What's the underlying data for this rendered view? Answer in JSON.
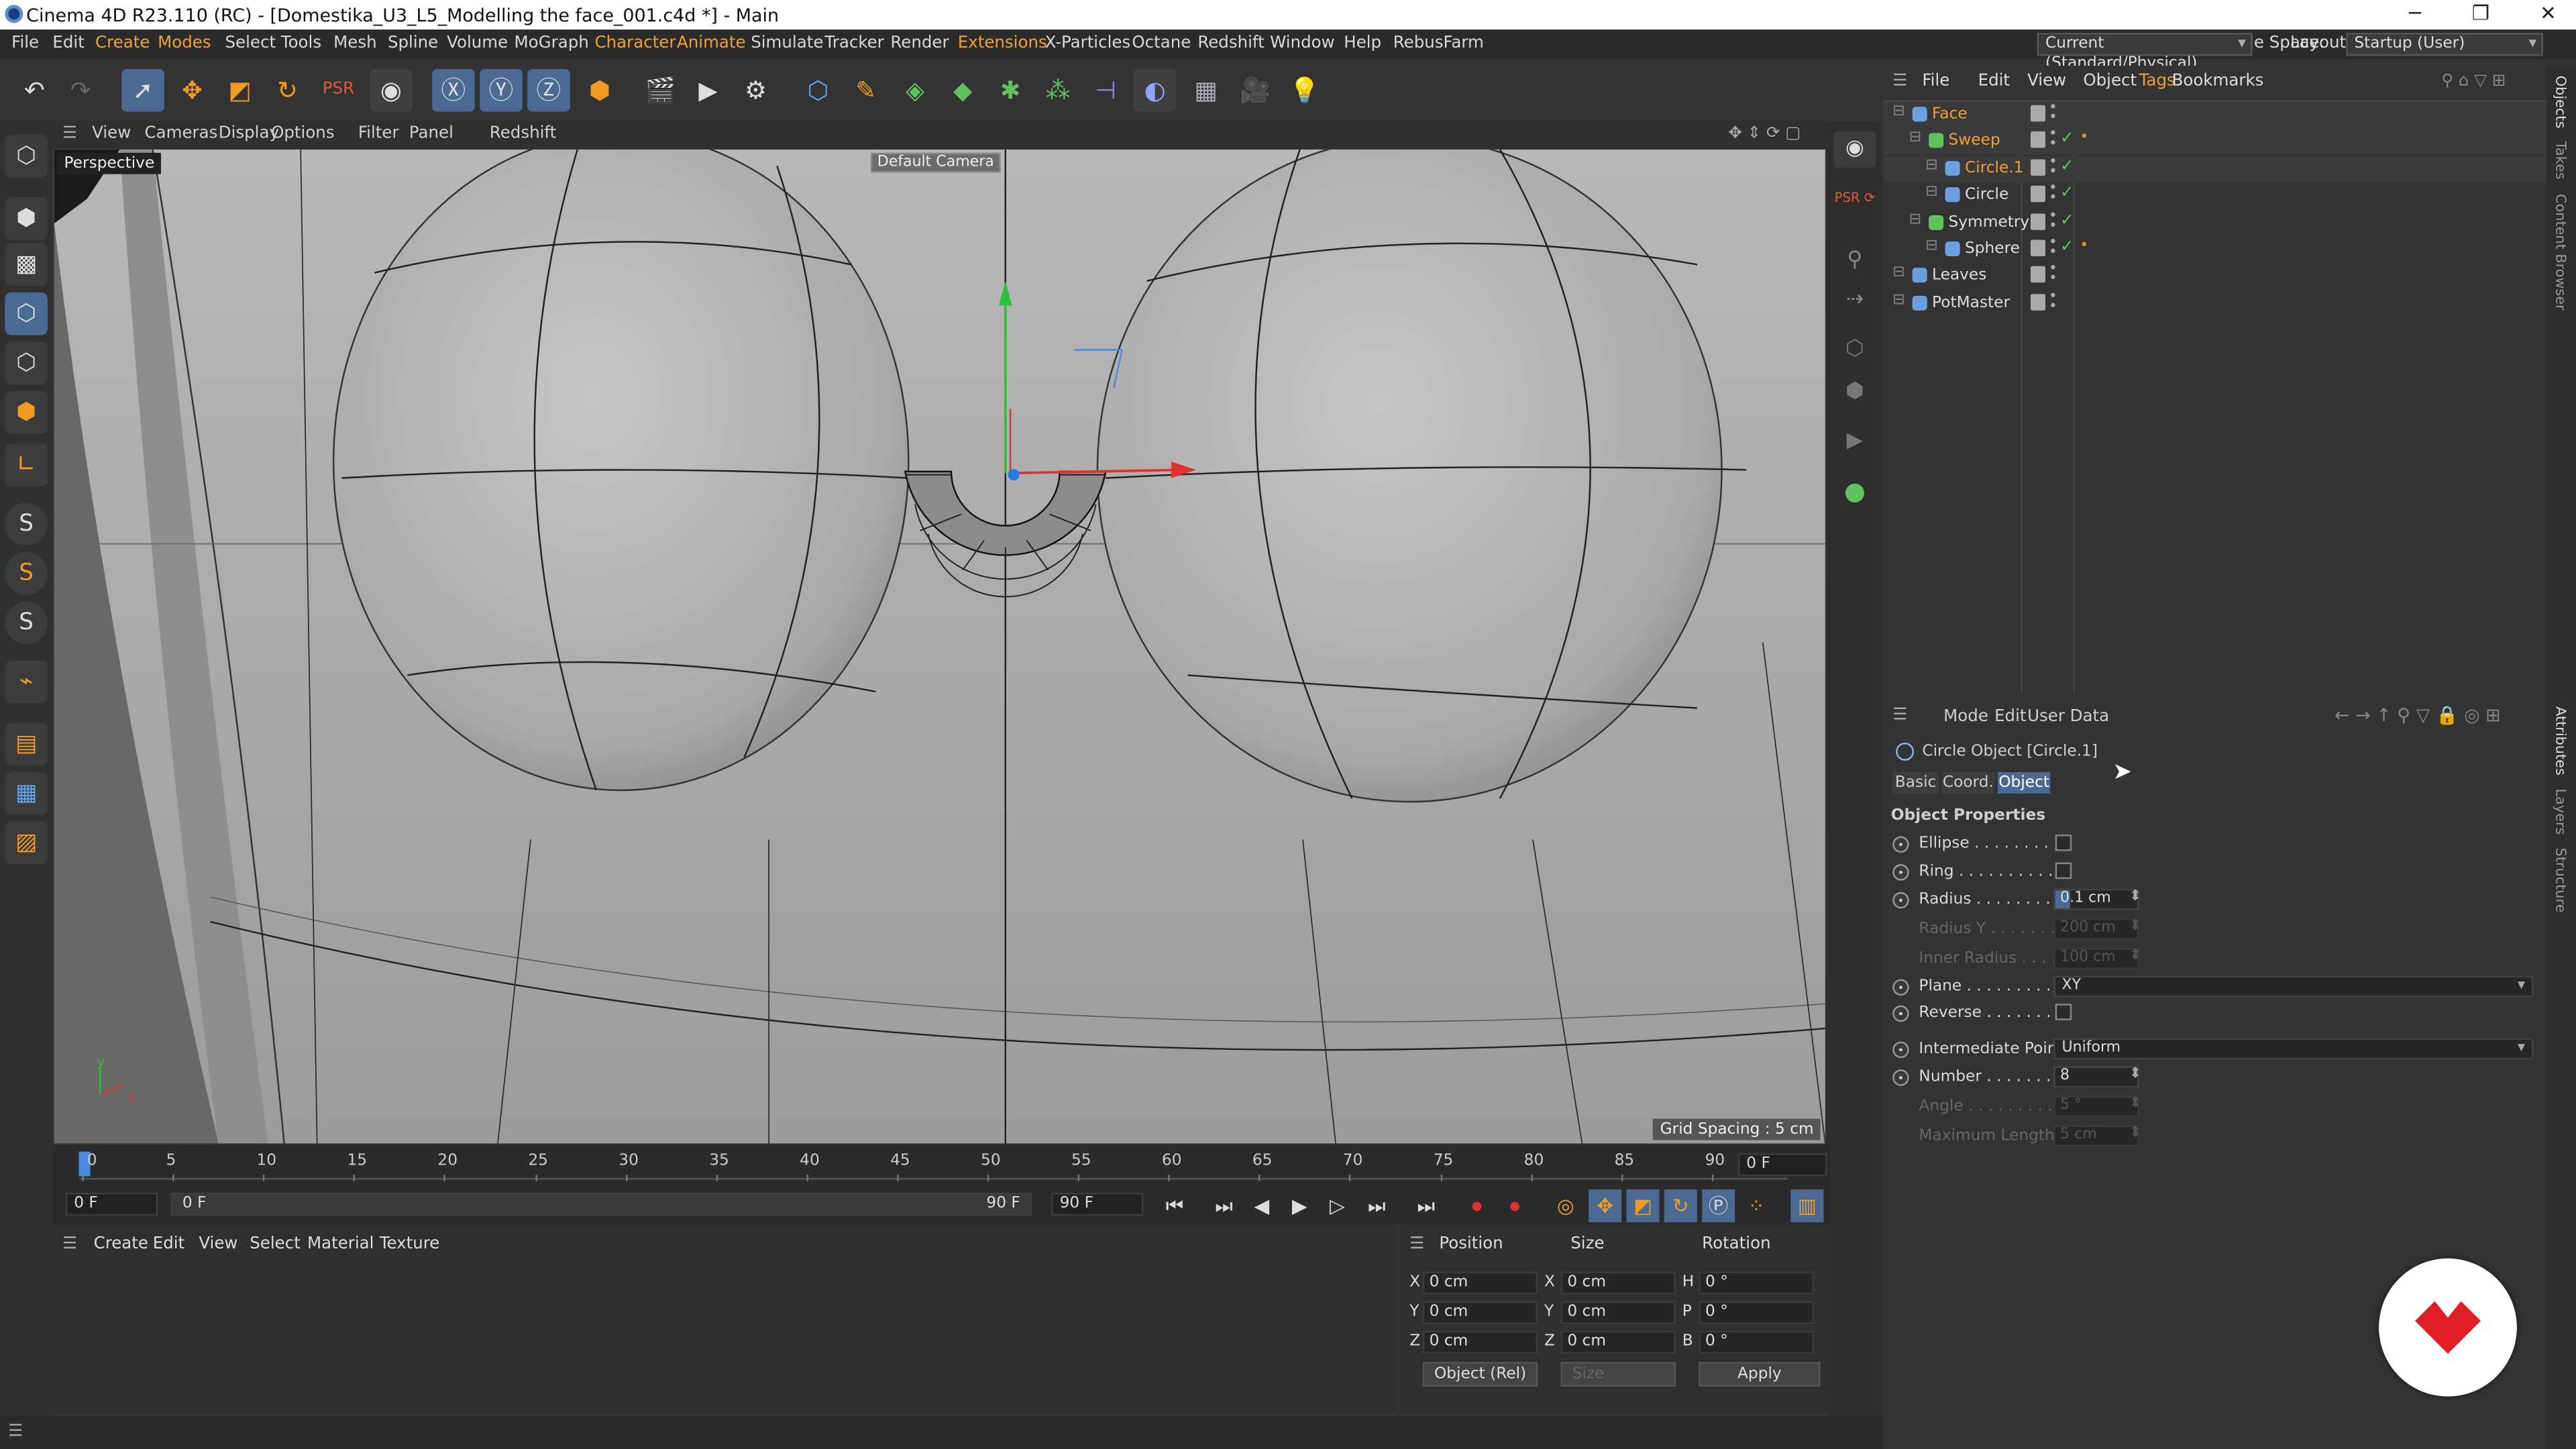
{
  "window": {
    "title": "Cinema 4D R23.110 (RC) - [Domestika_U3_L5_Modelling the face_001.c4d *] - Main",
    "minimize": "─",
    "restore": "❐",
    "close": "✕"
  },
  "menubar": {
    "items": [
      "File",
      "Edit",
      "Create",
      "Modes",
      "Select",
      "Tools",
      "Mesh",
      "Spline",
      "Volume",
      "MoGraph",
      "Character",
      "Animate",
      "Simulate",
      "Tracker",
      "Render",
      "Extensions",
      "X-Particles",
      "Octane",
      "Redshift",
      "Window",
      "Help",
      "RebusFarm"
    ],
    "node_space_label": "Node Space:",
    "node_space_value": "Current (Standard/Physical)",
    "layout_label": "Layout:",
    "layout_value": "Startup (User)"
  },
  "viewport": {
    "menu": [
      "View",
      "Cameras",
      "Display",
      "Options",
      "Filter",
      "Panel",
      "Redshift"
    ],
    "label": "Perspective",
    "camera": "Default Camera",
    "grid_spacing": "Grid Spacing : 5 cm",
    "axis_y": "y",
    "axis_x": "x"
  },
  "timeline": {
    "ticks": [
      "0",
      "5",
      "10",
      "15",
      "20",
      "25",
      "30",
      "35",
      "40",
      "45",
      "50",
      "55",
      "60",
      "65",
      "70",
      "75",
      "80",
      "85",
      "90"
    ],
    "current_frame": "0 F",
    "start_field": "0 F",
    "range_start": "0 F",
    "range_end": "90 F",
    "end_field": "90 F",
    "right_field": "0 F"
  },
  "material_manager": {
    "menu": [
      "Create",
      "Edit",
      "View",
      "Select",
      "Material",
      "Texture"
    ]
  },
  "coordinates": {
    "headers": {
      "position": "Position",
      "size": "Size",
      "rotation": "Rotation"
    },
    "rows": [
      {
        "axis": "X",
        "pos": "0 cm",
        "size_axis": "X",
        "size": "0 cm",
        "rot_axis": "H",
        "rot": "0 °"
      },
      {
        "axis": "Y",
        "pos": "0 cm",
        "size_axis": "Y",
        "size": "0 cm",
        "rot_axis": "P",
        "rot": "0 °"
      },
      {
        "axis": "Z",
        "pos": "0 cm",
        "size_axis": "Z",
        "size": "0 cm",
        "rot_axis": "B",
        "rot": "0 °"
      }
    ],
    "mode": "Object (Rel)",
    "size_mode": "Size",
    "apply": "Apply"
  },
  "object_manager": {
    "menu": [
      "File",
      "Edit",
      "View",
      "Object",
      "Tags",
      "Bookmarks"
    ],
    "objects": [
      {
        "name": "Face",
        "indent": 0,
        "color": "#f0a030",
        "icon_color": "#6aa0e0",
        "tag": false
      },
      {
        "name": "Sweep",
        "indent": 1,
        "color": "#f0a030",
        "icon_color": "#5fc25f",
        "tag": true
      },
      {
        "name": "Circle.1",
        "indent": 2,
        "color": "#f0a030",
        "icon_color": "#6aa0e0",
        "tag": false
      },
      {
        "name": "Circle",
        "indent": 2,
        "color": "#dddddd",
        "icon_color": "#6aa0e0",
        "tag": false
      },
      {
        "name": "Symmetry",
        "indent": 1,
        "color": "#dddddd",
        "icon_color": "#5fc25f",
        "tag": false
      },
      {
        "name": "Sphere",
        "indent": 2,
        "color": "#dddddd",
        "icon_color": "#6aa0e0",
        "tag": true
      },
      {
        "name": "Leaves",
        "indent": 0,
        "color": "#dddddd",
        "icon_color": "#6aa0e0",
        "tag": false
      },
      {
        "name": "PotMaster",
        "indent": 0,
        "color": "#dddddd",
        "icon_color": "#6aa0e0",
        "tag": false
      }
    ]
  },
  "attributes": {
    "menu": [
      "Mode",
      "Edit",
      "User Data"
    ],
    "title": "Circle Object [Circle.1]",
    "tabs": [
      "Basic",
      "Coord.",
      "Object"
    ],
    "section": "Object Properties",
    "rows": [
      {
        "label": "Ellipse . . . . . . . . .",
        "type": "check",
        "enabled": true
      },
      {
        "label": "Ring . . . . . . . . . . .",
        "type": "check",
        "enabled": true
      },
      {
        "label": "Radius . . . . . . . . .",
        "type": "num",
        "value": "0.1 cm",
        "enabled": true
      },
      {
        "label": "Radius Y . . . . . . .",
        "type": "num",
        "value": "200 cm",
        "enabled": false
      },
      {
        "label": "Inner Radius . . . . .",
        "type": "num",
        "value": "100 cm",
        "enabled": false
      },
      {
        "label": "Plane . . . . . . . . . .",
        "type": "select",
        "value": "XY",
        "enabled": true
      },
      {
        "label": "Reverse . . . . . . . .",
        "type": "check",
        "enabled": true
      },
      {
        "label": "Intermediate Points",
        "type": "select",
        "value": "Uniform",
        "enabled": true
      },
      {
        "label": "Number . . . . . . . .",
        "type": "num",
        "value": "8",
        "enabled": true
      },
      {
        "label": "Angle . . . . . . . . . .",
        "type": "num",
        "value": "5 °",
        "enabled": false
      },
      {
        "label": "Maximum Length",
        "type": "num",
        "value": "5 cm",
        "enabled": false
      }
    ]
  },
  "side_tabs": [
    "Objects",
    "Takes",
    "Content Browser",
    "Attributes",
    "Layers",
    "Structure"
  ],
  "colors": {
    "accent": "#f0a030",
    "selection": "#4b6a93",
    "logo_red": "#e01e26"
  }
}
